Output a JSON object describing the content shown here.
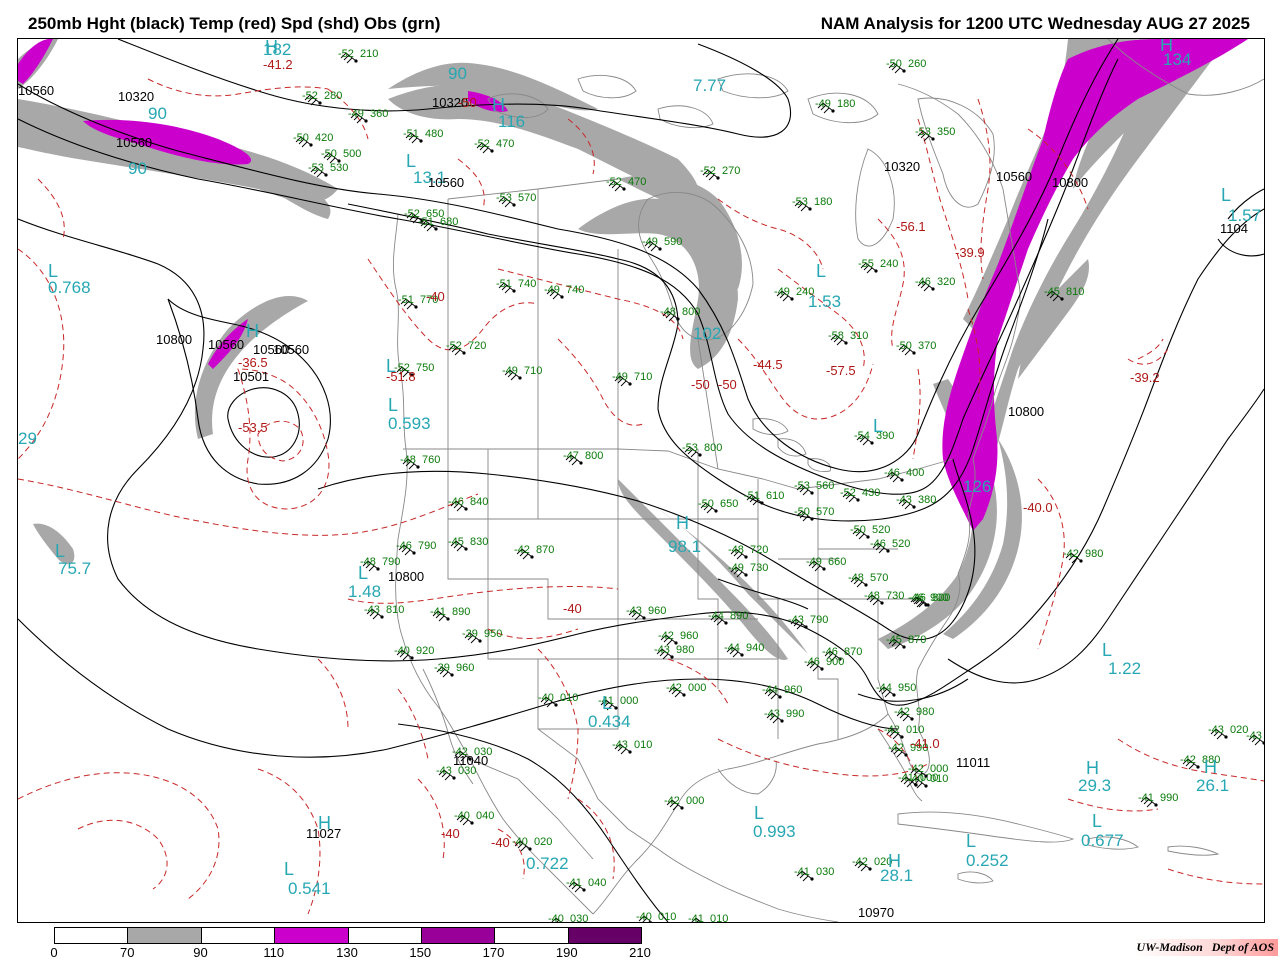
{
  "header": {
    "left_title": "250mb Hght (black) Temp (red) Spd (shd) Obs (grn)",
    "right_title": "NAM Analysis for 1200 UTC Wednesday  AUG 27 2025"
  },
  "credit": {
    "institution": "UW-Madison",
    "department": "Dept of AOS"
  },
  "colors": {
    "height": "#000000",
    "temperature": "#b01818",
    "speed_label": "#27a7b3",
    "obs": "#0a7a0a",
    "border": "#888888"
  },
  "colorbar": {
    "ticks": [
      "0",
      "70",
      "90",
      "110",
      "130",
      "150",
      "170",
      "190",
      "210"
    ],
    "segment_colors": [
      "#ffffff",
      "#a8a8a8",
      "#ffffff",
      "#cc00cc",
      "#ffffff",
      "#990099",
      "#ffffff",
      "#660066"
    ]
  },
  "speed_labels": [
    {
      "text": "182"
    },
    {
      "text": "90"
    },
    {
      "text": "90"
    },
    {
      "text": "90"
    },
    {
      "text": "116"
    },
    {
      "text": "0.768"
    },
    {
      "text": "29"
    },
    {
      "text": "0.593"
    },
    {
      "text": "75.7"
    },
    {
      "text": "1.48"
    },
    {
      "text": "0.434"
    },
    {
      "text": "0.993"
    },
    {
      "text": "0.541"
    },
    {
      "text": "0.722"
    },
    {
      "text": "7.77"
    },
    {
      "text": "1.53"
    },
    {
      "text": "102"
    },
    {
      "text": "98.1"
    },
    {
      "text": "1.22"
    },
    {
      "text": "29.3"
    },
    {
      "text": "26.1"
    },
    {
      "text": "0.677"
    },
    {
      "text": "0.252"
    },
    {
      "text": "28.1"
    },
    {
      "text": "134"
    },
    {
      "text": "1.57"
    },
    {
      "text": "126"
    },
    {
      "text": "13.1"
    }
  ],
  "height_labels": [
    {
      "text": "10560"
    },
    {
      "text": "10320"
    },
    {
      "text": "10560"
    },
    {
      "text": "10320"
    },
    {
      "text": "10560"
    },
    {
      "text": "10800"
    },
    {
      "text": "10560"
    },
    {
      "text": "10560"
    },
    {
      "text": "10501"
    },
    {
      "text": "10560"
    },
    {
      "text": "10800"
    },
    {
      "text": "11040"
    },
    {
      "text": "11027"
    },
    {
      "text": "10320"
    },
    {
      "text": "10560"
    },
    {
      "text": "10800"
    },
    {
      "text": "10800"
    },
    {
      "text": "1104"
    },
    {
      "text": "11011"
    },
    {
      "text": "10970"
    }
  ],
  "temp_labels": [
    {
      "text": "-41.2"
    },
    {
      "text": "-50"
    },
    {
      "text": "-36.5"
    },
    {
      "text": "-53.5"
    },
    {
      "text": "-51.8"
    },
    {
      "text": "-40"
    },
    {
      "text": "-40"
    },
    {
      "text": "-50"
    },
    {
      "text": "-44.5"
    },
    {
      "text": "-57.5"
    },
    {
      "text": "-56.1"
    },
    {
      "text": "-39.9"
    },
    {
      "text": "-39.2"
    },
    {
      "text": "-40.0"
    },
    {
      "text": "-41.0"
    },
    {
      "text": "-40"
    },
    {
      "text": "-40"
    },
    {
      "text": "-50"
    }
  ],
  "pressure_centers": [
    {
      "text": "H"
    },
    {
      "text": "L"
    },
    {
      "text": "L"
    },
    {
      "text": "H"
    },
    {
      "text": "L"
    },
    {
      "text": "L"
    },
    {
      "text": "L"
    },
    {
      "text": "L"
    },
    {
      "text": "L"
    },
    {
      "text": "L"
    },
    {
      "text": "H"
    },
    {
      "text": "L"
    },
    {
      "text": "H"
    },
    {
      "text": "L"
    },
    {
      "text": "L"
    },
    {
      "text": "H"
    },
    {
      "text": "H"
    },
    {
      "text": "L"
    },
    {
      "text": "H"
    },
    {
      "text": "L"
    },
    {
      "text": "H"
    },
    {
      "text": "L"
    },
    {
      "text": "H"
    },
    {
      "text": "L"
    }
  ],
  "station_obs": [
    {
      "t": "-52",
      "h": "210"
    },
    {
      "t": "-52",
      "h": "280"
    },
    {
      "t": "-49",
      "h": "360"
    },
    {
      "t": "-50",
      "h": "420"
    },
    {
      "t": "-50",
      "h": "500"
    },
    {
      "t": "-53",
      "h": "530"
    },
    {
      "t": "-51",
      "h": "480"
    },
    {
      "t": "-52",
      "h": "470"
    },
    {
      "t": "-53",
      "h": "570"
    },
    {
      "t": "-52",
      "h": "470"
    },
    {
      "t": "-52",
      "h": "270"
    },
    {
      "t": "-50",
      "h": "260"
    },
    {
      "t": "-49",
      "h": "180"
    },
    {
      "t": "-53",
      "h": "350"
    },
    {
      "t": "-53",
      "h": "180"
    },
    {
      "t": "-55",
      "h": "240"
    },
    {
      "t": "-49",
      "h": "590"
    },
    {
      "t": "-52",
      "h": "650"
    },
    {
      "t": "-51",
      "h": "680"
    },
    {
      "t": "-51",
      "h": "740"
    },
    {
      "t": "-49",
      "h": "740"
    },
    {
      "t": "-51",
      "h": "770"
    },
    {
      "t": "-52",
      "h": "720"
    },
    {
      "t": "-49",
      "h": "710"
    },
    {
      "t": "-48",
      "h": "800"
    },
    {
      "t": "-49",
      "h": "710"
    },
    {
      "t": "-52",
      "h": "750"
    },
    {
      "t": "-48",
      "h": "760"
    },
    {
      "t": "-47",
      "h": "800"
    },
    {
      "t": "-53",
      "h": "800"
    },
    {
      "t": "-46",
      "h": "840"
    },
    {
      "t": "-46",
      "h": "790"
    },
    {
      "t": "-45",
      "h": "830"
    },
    {
      "t": "-42",
      "h": "870"
    },
    {
      "t": "-48",
      "h": "790"
    },
    {
      "t": "-43",
      "h": "810"
    },
    {
      "t": "-41",
      "h": "890"
    },
    {
      "t": "-39",
      "h": "950"
    },
    {
      "t": "-40",
      "h": "920"
    },
    {
      "t": "-39",
      "h": "960"
    },
    {
      "t": "-43",
      "h": "960"
    },
    {
      "t": "-42",
      "h": "960"
    },
    {
      "t": "-43",
      "h": "980"
    },
    {
      "t": "-44",
      "h": "890"
    },
    {
      "t": "-44",
      "h": "940"
    },
    {
      "t": "-42",
      "h": "000"
    },
    {
      "t": "-40",
      "h": "010"
    },
    {
      "t": "-41",
      "h": "000"
    },
    {
      "t": "-43",
      "h": "010"
    },
    {
      "t": "-42",
      "h": "030"
    },
    {
      "t": "-42",
      "h": "000"
    },
    {
      "t": "-43",
      "h": "030"
    },
    {
      "t": "-40",
      "h": "040"
    },
    {
      "t": "-40",
      "h": "020"
    },
    {
      "t": "-41",
      "h": "040"
    },
    {
      "t": "-40",
      "h": "030"
    },
    {
      "t": "-40",
      "h": "010"
    },
    {
      "t": "-41",
      "h": "010"
    },
    {
      "t": "-41",
      "h": "030"
    },
    {
      "t": "-42",
      "h": "020"
    },
    {
      "t": "-42",
      "h": "010"
    },
    {
      "t": "-42",
      "h": "990"
    },
    {
      "t": "-42",
      "h": "980"
    },
    {
      "t": "-44",
      "h": "950"
    },
    {
      "t": "-45",
      "h": "870"
    },
    {
      "t": "-46",
      "h": "870"
    },
    {
      "t": "-46",
      "h": "900"
    },
    {
      "t": "-43",
      "h": "790"
    },
    {
      "t": "-44",
      "h": "960"
    },
    {
      "t": "-43",
      "h": "990"
    },
    {
      "t": "-46",
      "h": "800"
    },
    {
      "t": "-48",
      "h": "730"
    },
    {
      "t": "-49",
      "h": "660"
    },
    {
      "t": "-49",
      "h": "730"
    },
    {
      "t": "-48",
      "h": "720"
    },
    {
      "t": "-50",
      "h": "650"
    },
    {
      "t": "-51",
      "h": "610"
    },
    {
      "t": "-53",
      "h": "560"
    },
    {
      "t": "-50",
      "h": "570"
    },
    {
      "t": "-52",
      "h": "430"
    },
    {
      "t": "-50",
      "h": "520"
    },
    {
      "t": "-46",
      "h": "520"
    },
    {
      "t": "-46",
      "h": "400"
    },
    {
      "t": "-43",
      "h": "380"
    },
    {
      "t": "-54",
      "h": "390"
    },
    {
      "t": "-58",
      "h": "310"
    },
    {
      "t": "-50",
      "h": "370"
    },
    {
      "t": "-49",
      "h": "240"
    },
    {
      "t": "-46",
      "h": "320"
    },
    {
      "t": "-45",
      "h": "810"
    },
    {
      "t": "-48",
      "h": "570"
    },
    {
      "t": "-46",
      "h": "900"
    },
    {
      "t": "-42",
      "h": "980"
    },
    {
      "t": "-43",
      "h": "990"
    },
    {
      "t": "-42",
      "h": "880"
    },
    {
      "t": "-41",
      "h": "990"
    },
    {
      "t": "-43",
      "h": "020"
    },
    {
      "t": "-41",
      "h": "000"
    },
    {
      "t": "-42",
      "h": "000"
    },
    {
      "t": "-40",
      "h": "010"
    }
  ]
}
